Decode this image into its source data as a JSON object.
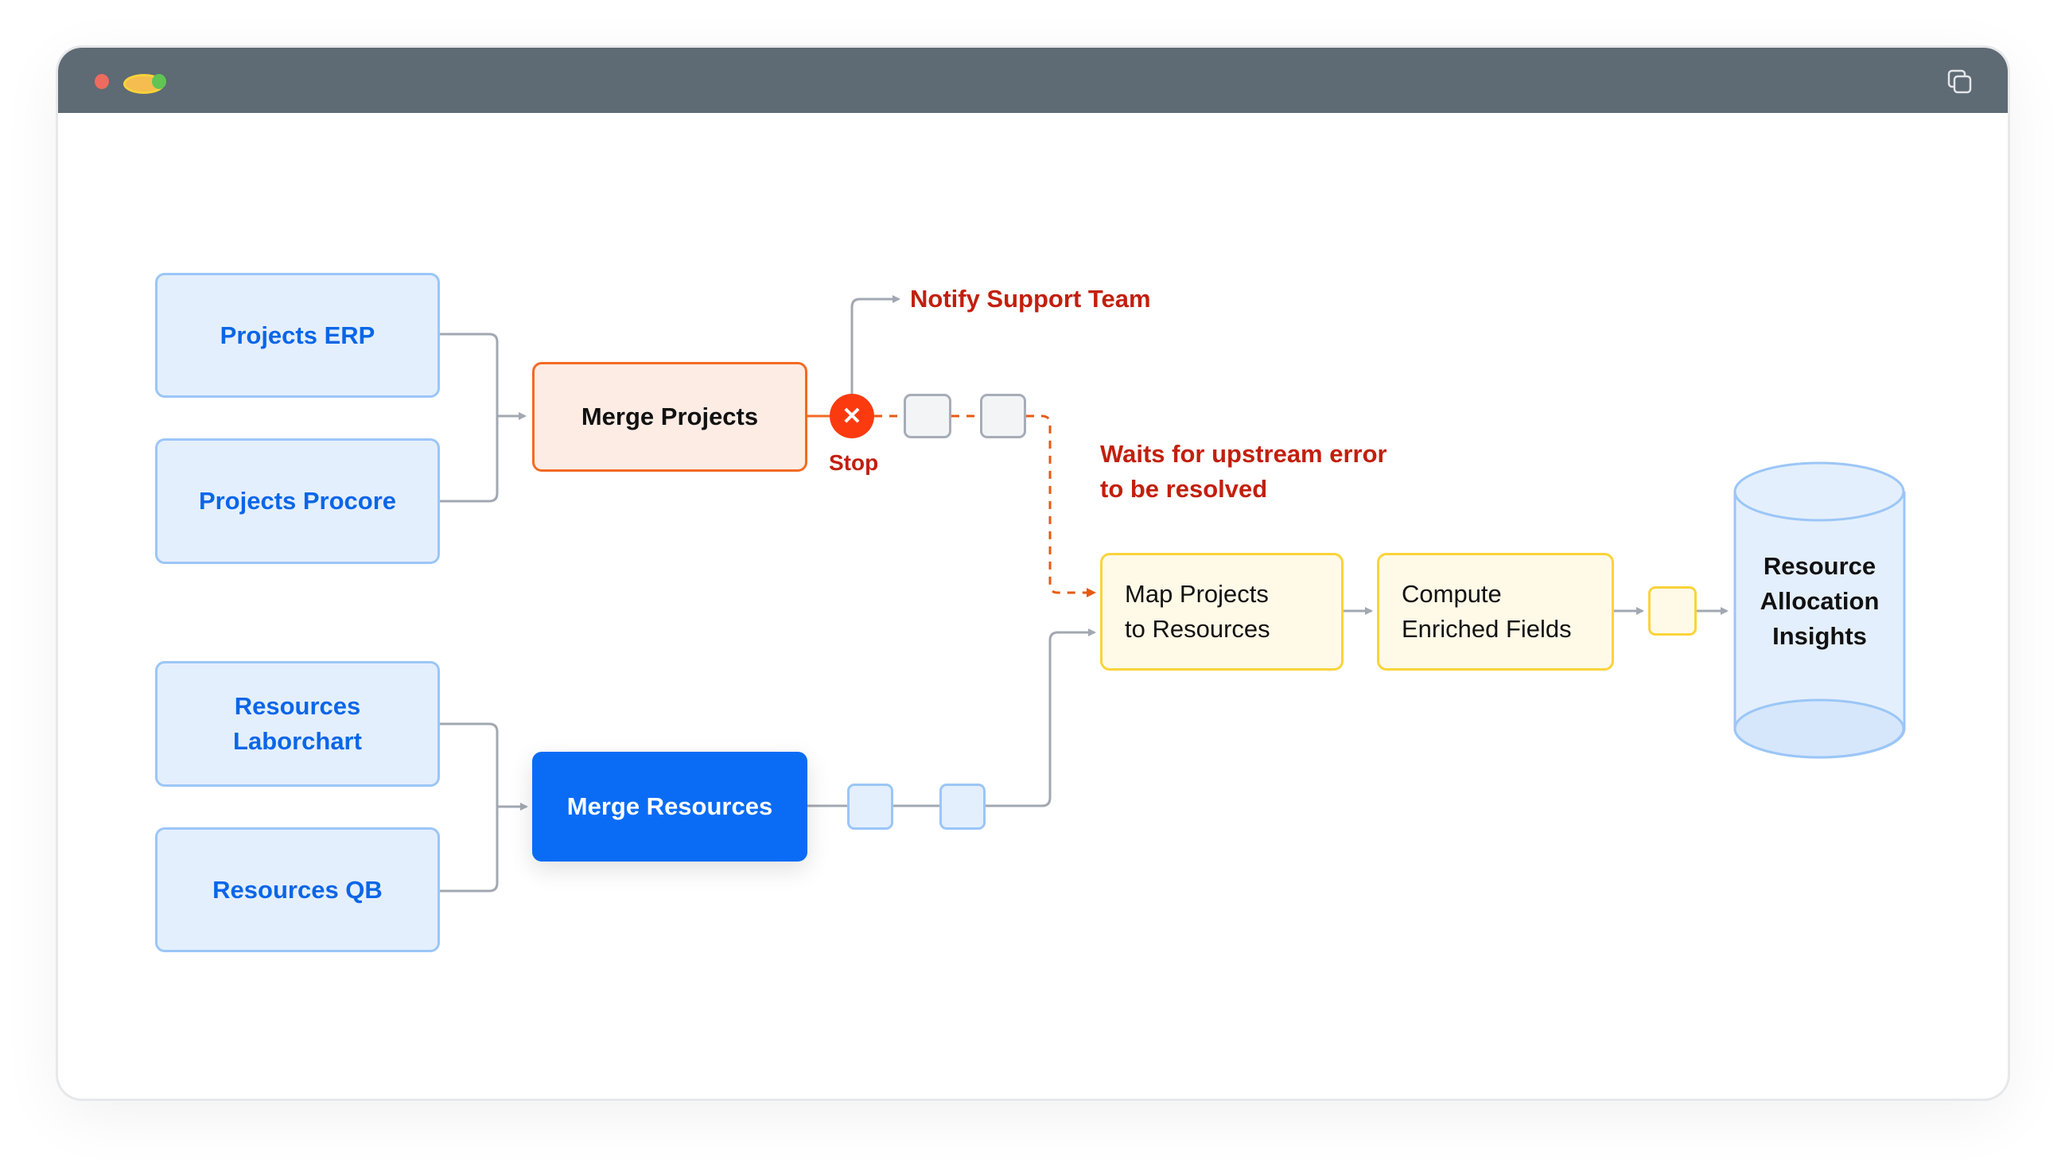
{
  "window": {
    "controls": [
      "close",
      "minimize",
      "maximize"
    ],
    "action_icon": "copy-icon"
  },
  "diagram": {
    "sources": {
      "projects_erp": "Projects ERP",
      "projects_procore": "Projects Procore",
      "resources_laborchart": "Resources Laborchart",
      "resources_qb": "Resources QB"
    },
    "merge_projects": {
      "label": "Merge Projects",
      "status": "error"
    },
    "merge_resources": {
      "label": "Merge Resources",
      "status": "active"
    },
    "stop": {
      "icon": "x-icon",
      "label": "Stop"
    },
    "notify": "Notify Support Team",
    "waits_note_line1": "Waits for upstream error",
    "waits_note_line2": "to be resolved",
    "map_projects": {
      "line1": "Map Projects",
      "line2": "to Resources"
    },
    "compute": {
      "line1": "Compute",
      "line2": "Enriched Fields"
    },
    "destination": {
      "line1": "Resource",
      "line2": "Allocation",
      "line3": "Insights"
    }
  },
  "colors": {
    "titlebar": "#5e6a74",
    "source_fill": "#e4effd",
    "source_border": "#9bc6f7",
    "source_text": "#0a66e8",
    "error_border": "#f36a22",
    "error_fill": "#fdece4",
    "stop_red": "#fb3a10",
    "note_red": "#c21f0d",
    "active_blue": "#0a6cf5",
    "pending_fill": "#fff9e7",
    "pending_border": "#fbd33a",
    "connector_gray": "#a2a8b1"
  }
}
